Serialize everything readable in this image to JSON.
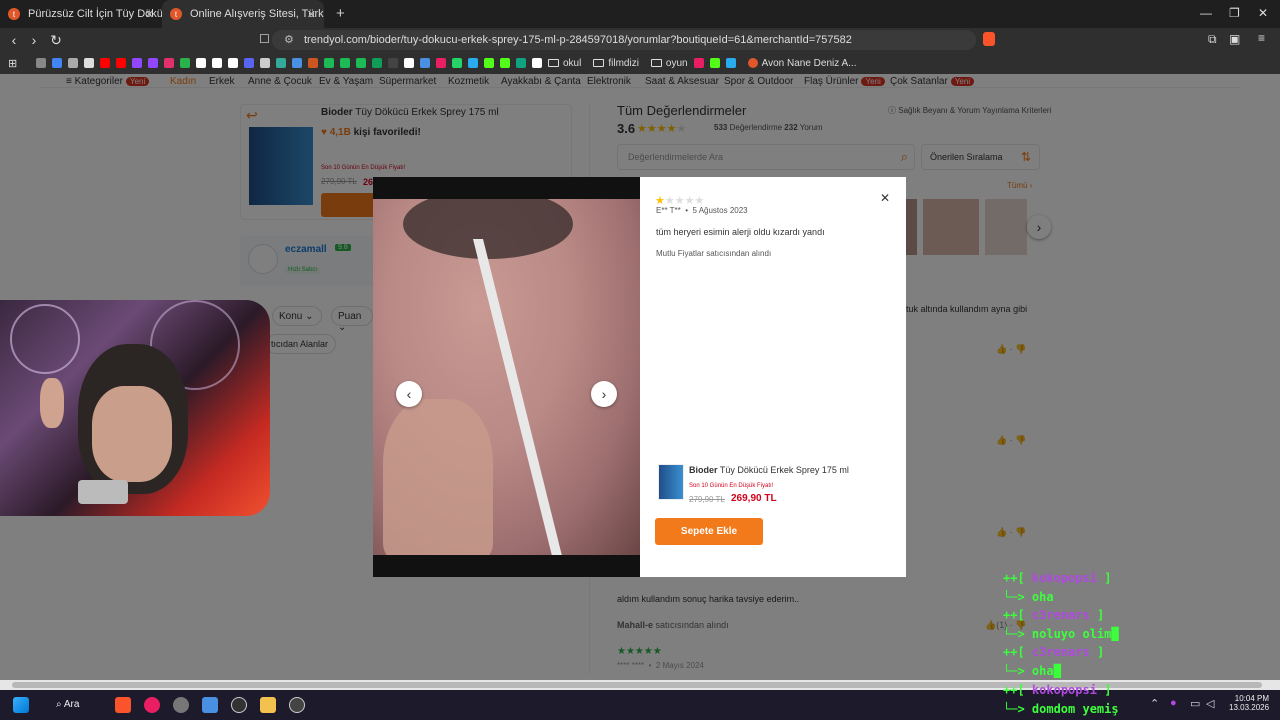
{
  "browser": {
    "tabs": [
      {
        "title": "Pürüzsüz Cilt İçin Tüy Dökücü Kremle",
        "active": false
      },
      {
        "title": "Online Alışveriş Sitesi, Türkiye'nin",
        "active": true
      }
    ],
    "url": "trendyol.com/bioder/tuy-dokucu-erkek-sprey-175-ml-p-284597018/yorumlar?boutiqueId=61&merchantId=757582",
    "bookmarks": [
      "okul",
      "filmdizi",
      "oyun",
      "Avon Nane Deniz A..."
    ]
  },
  "nav": {
    "categories": [
      "Kategoriler",
      "Kadın",
      "Erkek",
      "Anne & Çocuk",
      "Ev & Yaşam",
      "Süpermarket",
      "Kozmetik",
      "Ayakkabı & Çanta",
      "Elektronik",
      "Saat & Aksesuar",
      "Spor & Outdoor",
      "Flaş Ürünler",
      "Çok Satanlar"
    ],
    "new_badge": "Yeni"
  },
  "product": {
    "brand": "Bioder",
    "name": "Tüy Dökücü Erkek Sprey 175 ml",
    "favorites": "4,1B",
    "favorites_suffix": "kişi favoriledi!",
    "lowest_price_note": "Son 10 Günün En Düşük Fiyatı!",
    "old_price": "279,90 TL",
    "price": "269,90 TL",
    "price_partial": "26"
  },
  "seller": {
    "name": "eczamall",
    "score": "9.8",
    "badge": "Hızlı Satıcı"
  },
  "filters": {
    "topic": "Konu",
    "score": "Puan",
    "seller_filter": "tıcıdan Alanlar"
  },
  "reviews": {
    "title": "Tüm Değerlendirmeler",
    "policy": "Sağlık Beyanı & Yorum Yayınlama Kriterleri",
    "rating": "3.6",
    "rating_value": 3.6,
    "count": "533",
    "count_label": "Değerlendirme",
    "comments": "232",
    "comments_label": "Yorum",
    "search_placeholder": "Değerlendirmelerde Ara",
    "sort": "Önerilen Sıralama",
    "all_label": "Tümü",
    "side_text": "tuk altında kullandım ayna gibi",
    "review2_text": "aldım kullandım sonuç harika tavsiye ederim..",
    "review2_seller": "Mahall-e",
    "review2_seller_suffix": "satıcısından alındı",
    "review3_author": "**** ****",
    "review3_date": "2 Mayıs 2024",
    "review3_stars": 5
  },
  "modal": {
    "stars": 1,
    "author": "E** T**",
    "date": "5 Ağustos 2023",
    "comment": "tüm heryeri esimin alerji oldu kızardı yandı",
    "seller_note": "Mutlu Fiyatlar satıcısından alındı",
    "product_brand": "Bioder",
    "product_name": "Tüy Dökücü Erkek Sprey 175 ml",
    "lowest_price_note": "Son 10 Günün En Düşük Fiyatı!",
    "old_price": "279,90 TL",
    "price": "269,90 TL",
    "add_to_cart": "Sepete Ekle"
  },
  "chat": [
    {
      "user": "kokopopsi",
      "msg": "oha",
      "user_color": "#b04ae0"
    },
    {
      "user": "c3renars",
      "msg": "noluyo olim",
      "user_color": "#b04ae0"
    },
    {
      "user": "c3renars",
      "msg": "oha",
      "user_color": "#b04ae0"
    },
    {
      "user": "kokopopsi",
      "msg": "domdom yemiş",
      "user_color": "#b04ae0"
    }
  ],
  "taskbar": {
    "search": "Ara",
    "time": "10:04 PM",
    "date": "13.03.2026"
  },
  "colors": {
    "accent": "#f27a1a",
    "price": "#d0021b",
    "star": "#ffc000",
    "chat_green": "#3cff3c"
  }
}
